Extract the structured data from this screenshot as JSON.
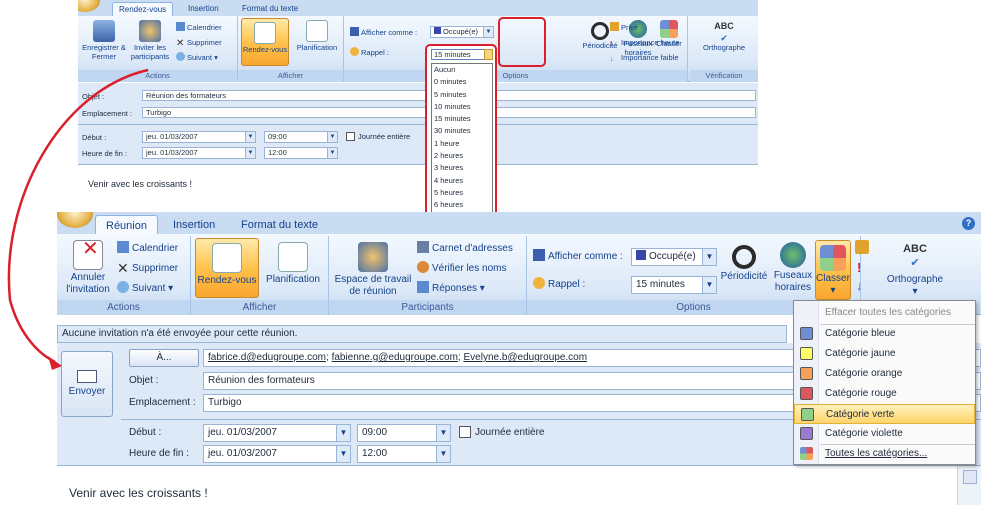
{
  "top": {
    "tabs": [
      "Rendez-vous",
      "Insertion",
      "Format du texte"
    ],
    "groups": {
      "actions": {
        "label": "Actions",
        "save_close": "Enregistrer & Fermer",
        "invite": "Inviter les participants",
        "calendar": "Calendrier",
        "delete": "Supprimer",
        "next": "Suivant"
      },
      "show": {
        "label": "Afficher",
        "appointment": "Rendez-vous",
        "planning": "Planification"
      },
      "options": {
        "label": "Options",
        "show_as_label": "Afficher comme :",
        "show_as_value": "Occupé(e)",
        "reminder_label": "Rappel :",
        "recurrence": "Périodicité",
        "timezones": "Fuseaux horaires",
        "classify": "Classer",
        "private": "Privé",
        "high": "Importance haute",
        "low": "Importance faible"
      },
      "check": {
        "label": "Vérification",
        "spelling": "Orthographe"
      }
    },
    "form": {
      "subject_label": "Objet :",
      "subject": "Réunion des formateurs",
      "location_label": "Emplacement :",
      "location": "Turbigo",
      "start_label": "Début :",
      "start_date": "jeu. 01/03/2007",
      "start_time": "09:00",
      "allday": "Journée entière",
      "end_label": "Heure de fin :",
      "end_date": "jeu. 01/03/2007",
      "end_time": "12:00",
      "body": "Venir avec les croissants !"
    },
    "reminder_dropdown": {
      "selected": "15 minutes",
      "options": [
        "Aucun",
        "0 minutes",
        "5 minutes",
        "10 minutes",
        "15 minutes",
        "30 minutes",
        "1 heure",
        "2 heures",
        "3 heures",
        "4 heures",
        "5 heures",
        "6 heures"
      ]
    }
  },
  "bottom": {
    "tabs": [
      "Réunion",
      "Insertion",
      "Format du texte"
    ],
    "groups": {
      "actions": {
        "label": "Actions",
        "cancel": "Annuler l'invitation",
        "calendar": "Calendrier",
        "delete": "Supprimer",
        "next": "Suivant"
      },
      "show": {
        "label": "Afficher",
        "appointment": "Rendez-vous",
        "planning": "Planification"
      },
      "participants": {
        "label": "Participants",
        "workspace": "Espace de travail de réunion",
        "address_book": "Carnet d'adresses",
        "check_names": "Vérifier les noms",
        "responses": "Réponses"
      },
      "options": {
        "label": "Options",
        "show_as_label": "Afficher comme :",
        "show_as_value": "Occupé(e)",
        "reminder_label": "Rappel :",
        "reminder_value": "15 minutes",
        "recurrence": "Périodicité",
        "timezones": "Fuseaux horaires",
        "classify": "Classer"
      },
      "check": {
        "spelling": "Orthographe"
      }
    },
    "infobar": "Aucune invitation n'a été envoyée pour cette réunion.",
    "form": {
      "send": "Envoyer",
      "to_button": "À...",
      "to_recipients": [
        "fabrice.d@edugroupe.com",
        "fabienne.g@edugroupe.com",
        "Evelyne.b@edugroupe.com"
      ],
      "subject_label": "Objet :",
      "subject": "Réunion des formateurs",
      "location_label": "Emplacement :",
      "location": "Turbigo",
      "start_label": "Début :",
      "start_date": "jeu. 01/03/2007",
      "start_time": "09:00",
      "allday": "Journée entière",
      "end_label": "Heure de fin :",
      "end_date": "jeu. 01/03/2007",
      "end_time": "12:00",
      "body": "Venir avec les croissants !"
    },
    "categories": {
      "clear": "Effacer toutes les catégories",
      "items": [
        {
          "label": "Catégorie bleue",
          "color": "#6e8fd4"
        },
        {
          "label": "Catégorie jaune",
          "color": "#ffff66"
        },
        {
          "label": "Catégorie orange",
          "color": "#f7a05a"
        },
        {
          "label": "Catégorie rouge",
          "color": "#e0565e"
        },
        {
          "label": "Catégorie verte",
          "color": "#8fd18a"
        },
        {
          "label": "Catégorie violette",
          "color": "#9b7ad3"
        }
      ],
      "all": "Toutes les catégories..."
    }
  },
  "colors": {
    "annotation_red": "#d9202b",
    "ribbon_blue": "#c1d7f1"
  }
}
